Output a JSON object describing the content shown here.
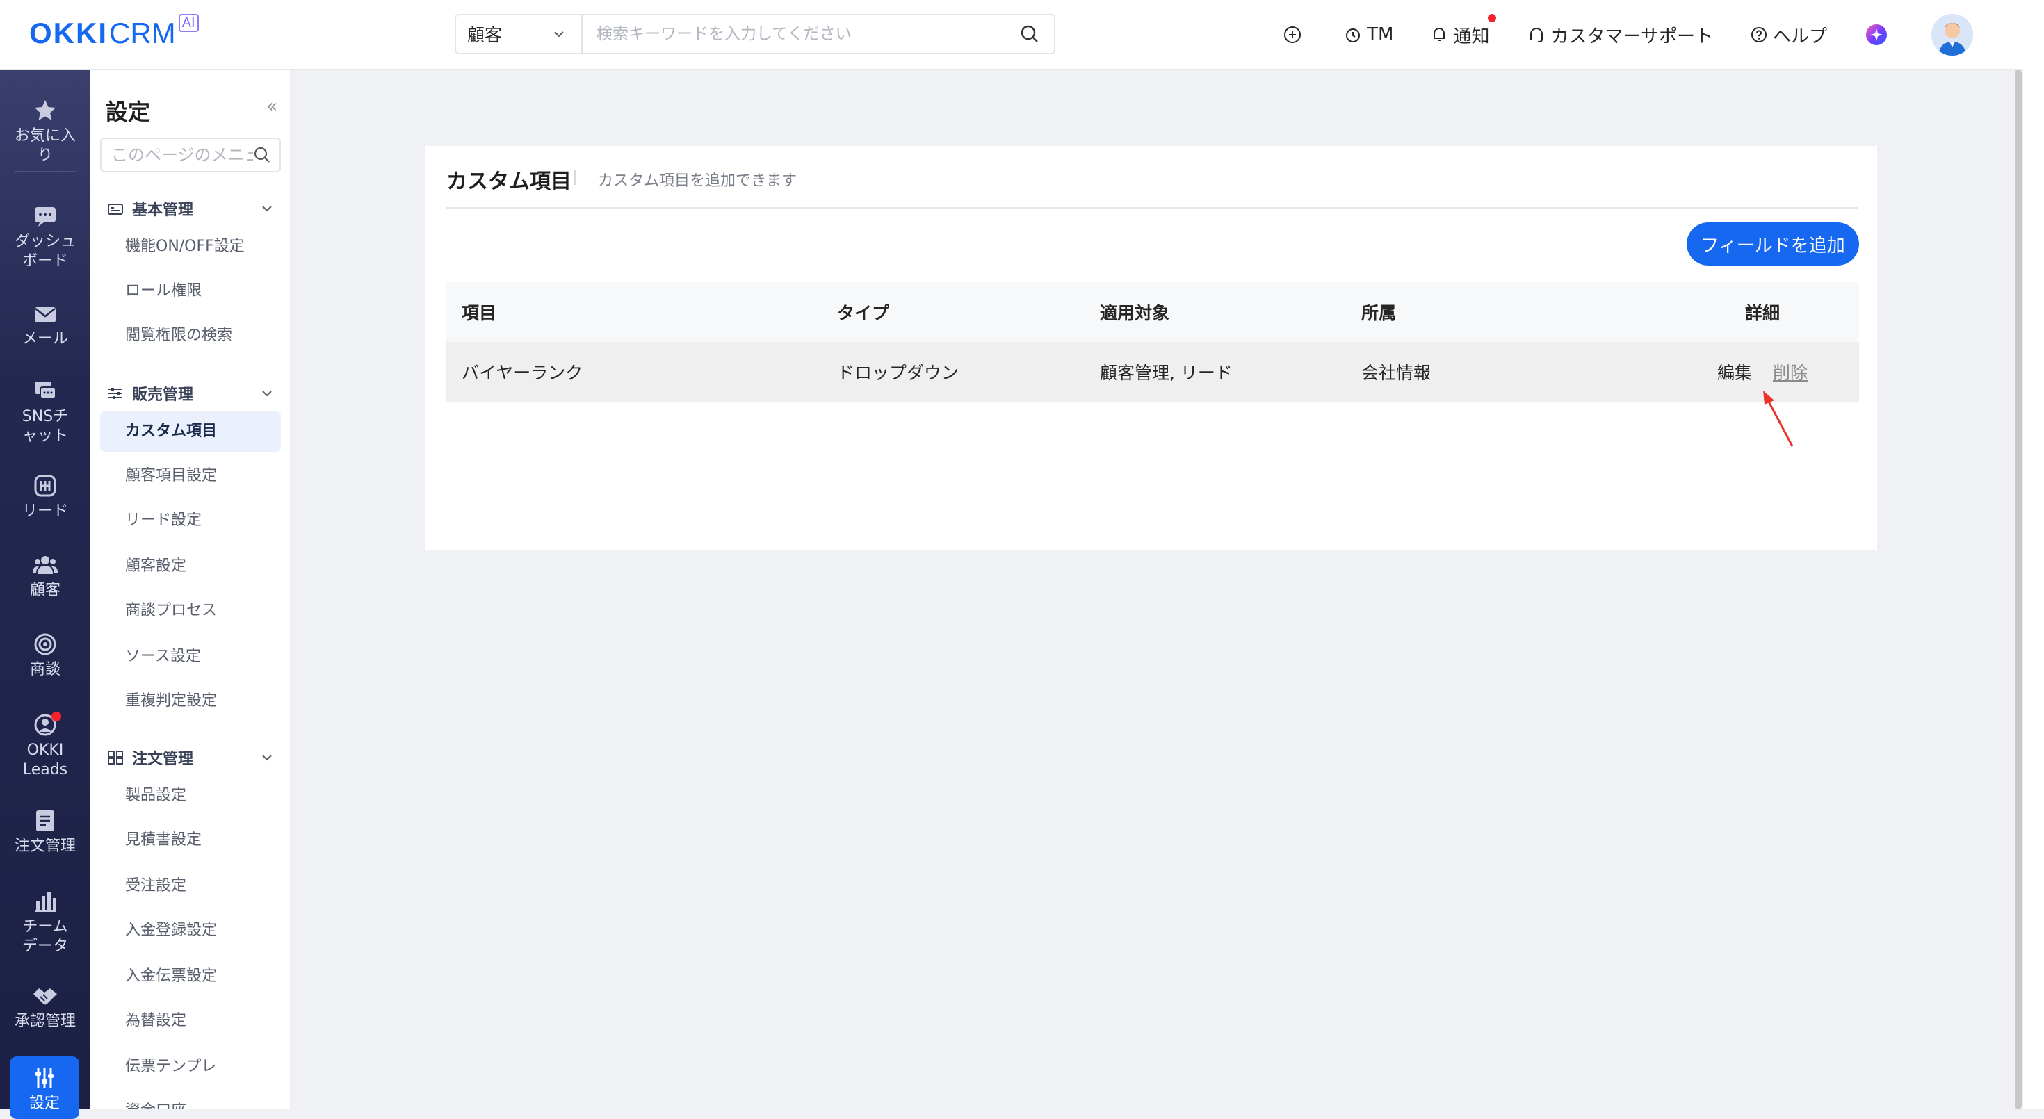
{
  "header": {
    "logo_okki": "OKKI",
    "logo_crm": "CRM",
    "logo_ai": "AI",
    "search_scope": "顧客",
    "search_placeholder": "検索キーワードを入力してください",
    "tm_label": "TM",
    "notify_label": "通知",
    "support_label": "カスタマーサポート",
    "help_label": "ヘルプ"
  },
  "nav": {
    "favorites": "お気に入り",
    "dashboard": "ダッシュボード",
    "mail": "メール",
    "sns": "SNSチャット",
    "lead": "リード",
    "customer": "顧客",
    "deal": "商談",
    "okki_leads": "OKKI Leads",
    "order": "注文管理",
    "team_data": "チームデータ",
    "approval": "承認管理",
    "settings": "設定"
  },
  "sidebar": {
    "title": "設定",
    "collapse": "«",
    "search_placeholder": "このページのメニューを検索",
    "groups": [
      {
        "label": "基本管理",
        "items": [
          "機能ON/OFF設定",
          "ロール権限",
          "閲覧権限の検索"
        ]
      },
      {
        "label": "販売管理",
        "items": [
          "カスタム項目",
          "顧客項目設定",
          "リード設定",
          "顧客設定",
          "商談プロセス",
          "ソース設定",
          "重複判定設定"
        ]
      },
      {
        "label": "注文管理",
        "items": [
          "製品設定",
          "見積書設定",
          "受注設定",
          "入金登録設定",
          "入金伝票設定",
          "為替設定",
          "伝票テンプレ",
          "資金口座"
        ]
      }
    ]
  },
  "main": {
    "title": "カスタム項目",
    "subtitle": "カスタム項目を追加できます",
    "add_button": "フィールドを追加",
    "columns": [
      "項目",
      "タイプ",
      "適用対象",
      "所属",
      "詳細"
    ],
    "rows": [
      {
        "item": "バイヤーランク",
        "type": "ドロップダウン",
        "target": "顧客管理, リード",
        "belongs": "会社情報",
        "edit": "編集",
        "delete": "削除"
      }
    ]
  },
  "colors": {
    "brand": "#1668f0",
    "nav_bg": "#1c2044",
    "alert": "#f5222d",
    "annotation": "#e8342c"
  }
}
